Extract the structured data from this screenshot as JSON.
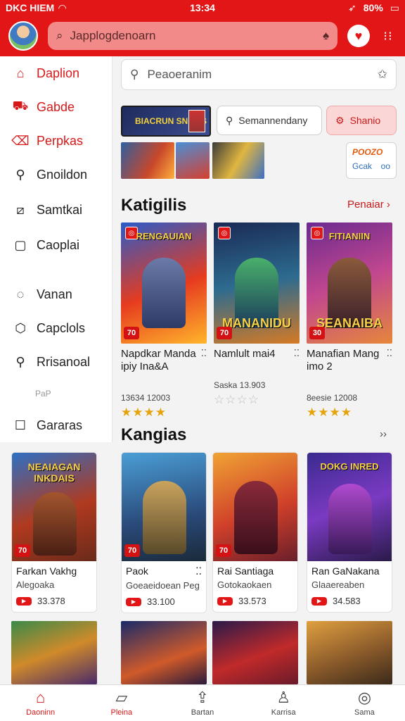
{
  "status_bar": {
    "left": "DKC HIEM",
    "time": "13:34",
    "battery": "80%"
  },
  "header": {
    "search_placeholder": "Japplogdenoarn"
  },
  "sidebar": {
    "items": [
      {
        "label": "Daplion",
        "icon": "home-icon",
        "highlight": true
      },
      {
        "label": "Gabde",
        "icon": "cart-icon",
        "highlight": true
      },
      {
        "label": "Perpkas",
        "icon": "tag-icon",
        "highlight": true
      },
      {
        "label": "Gnoildon",
        "icon": "search-icon",
        "highlight": false
      },
      {
        "label": "Samtkai",
        "icon": "chart-icon",
        "highlight": false
      },
      {
        "label": "Caoplai",
        "icon": "page-icon",
        "highlight": false
      },
      {
        "label": "Vanan",
        "icon": "chat-icon",
        "highlight": false
      },
      {
        "label": "Capclols",
        "icon": "puzzle-icon",
        "highlight": false
      },
      {
        "label": "Rrisanoal",
        "icon": "magnifier-icon",
        "highlight": false
      },
      {
        "label": "Gararas",
        "icon": "square-icon",
        "highlight": false
      }
    ],
    "faded": "PaP"
  },
  "main": {
    "search_placeholder": "Peaoeranim",
    "banner_text": "BIACRUN SNIELS",
    "chip_gray": "Semannendany",
    "chip_pink": "Shanio",
    "badge_top": "POOZO",
    "badge_bottom_left": "Gcak",
    "badge_bottom_right": "oo"
  },
  "section1": {
    "title": "Katigilis",
    "link": "Penaiar",
    "cards": [
      {
        "top_label": "RENGAUIAN",
        "bottom_label": "",
        "corner": "70",
        "title": "Napdkar Manda ipiy Ina&A",
        "meta": "13634 12003",
        "rating": 4
      },
      {
        "top_label": "",
        "bottom_label": "MANANIDU",
        "corner": "70",
        "title": "Namlult mai4",
        "meta": "Saska 13.903",
        "rating": 0
      },
      {
        "top_label": "FITIANIIN",
        "bottom_label": "SEANAIBA",
        "corner": "30",
        "title": "Manafian Mang imo 2",
        "meta": "8eesie 12008",
        "rating": 4
      }
    ]
  },
  "section2": {
    "title": "Kangias",
    "cards": [
      {
        "art_label": "NEAIAGAN INKDAIS",
        "corner": "70",
        "name": "Farkan Vakhg",
        "sub": "Alegoaka",
        "price": "33.378"
      },
      {
        "art_label": "",
        "corner": "70",
        "name": "Paok",
        "sub": "Goeaeidoean Peg",
        "price": "33.100"
      },
      {
        "art_label": "",
        "corner": "70",
        "name": "Rai Santiaga",
        "sub": "Gotokaokaen",
        "price": "33.573"
      },
      {
        "art_label": "DOKG INRED",
        "corner": "",
        "name": "Ran GaNakana",
        "sub": "Glaaereaben",
        "price": "34.583"
      }
    ]
  },
  "bottom_nav": [
    {
      "label": "Daoninn",
      "icon": "home-icon",
      "active": true
    },
    {
      "label": "Pleina",
      "icon": "map-icon",
      "active": false
    },
    {
      "label": "Bartan",
      "icon": "share-icon",
      "active": false
    },
    {
      "label": "Karrisa",
      "icon": "user-icon",
      "active": false
    },
    {
      "label": "Sama",
      "icon": "compass-icon",
      "active": false
    }
  ]
}
